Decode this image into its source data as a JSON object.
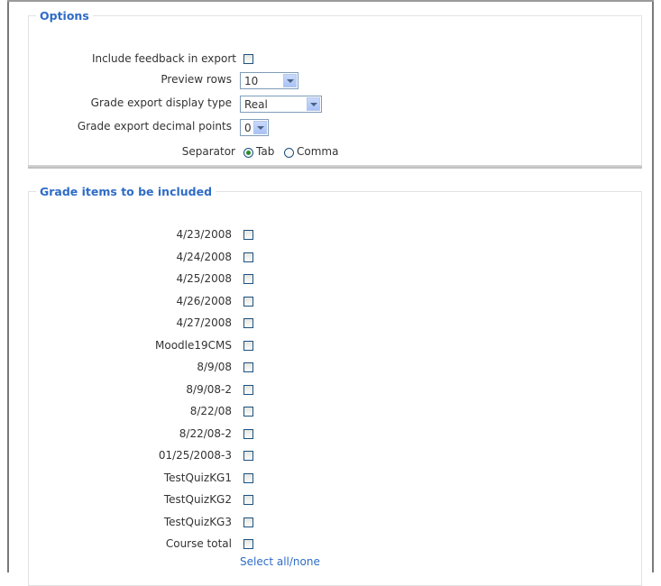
{
  "options": {
    "legend": "Options",
    "include_feedback_label": "Include feedback in export",
    "preview_rows_label": "Preview rows",
    "preview_rows_value": "10",
    "display_type_label": "Grade export display type",
    "display_type_value": "Real",
    "decimal_points_label": "Grade export decimal points",
    "decimal_points_value": "0",
    "separator_label": "Separator",
    "separator_tab": "Tab",
    "separator_comma": "Comma",
    "separator_selected": "Tab"
  },
  "grade_items": {
    "legend": "Grade items to be included",
    "items": [
      {
        "label": "4/23/2008"
      },
      {
        "label": "4/24/2008"
      },
      {
        "label": "4/25/2008"
      },
      {
        "label": "4/26/2008"
      },
      {
        "label": "4/27/2008"
      },
      {
        "label": "Moodle19CMS"
      },
      {
        "label": "8/9/08"
      },
      {
        "label": "8/9/08-2"
      },
      {
        "label": "8/22/08"
      },
      {
        "label": "8/22/08-2"
      },
      {
        "label": "01/25/2008-3"
      },
      {
        "label": "TestQuizKG1"
      },
      {
        "label": "TestQuizKG2"
      },
      {
        "label": "TestQuizKG3"
      },
      {
        "label": "Course total"
      }
    ],
    "select_all_label": "Select all/none"
  }
}
